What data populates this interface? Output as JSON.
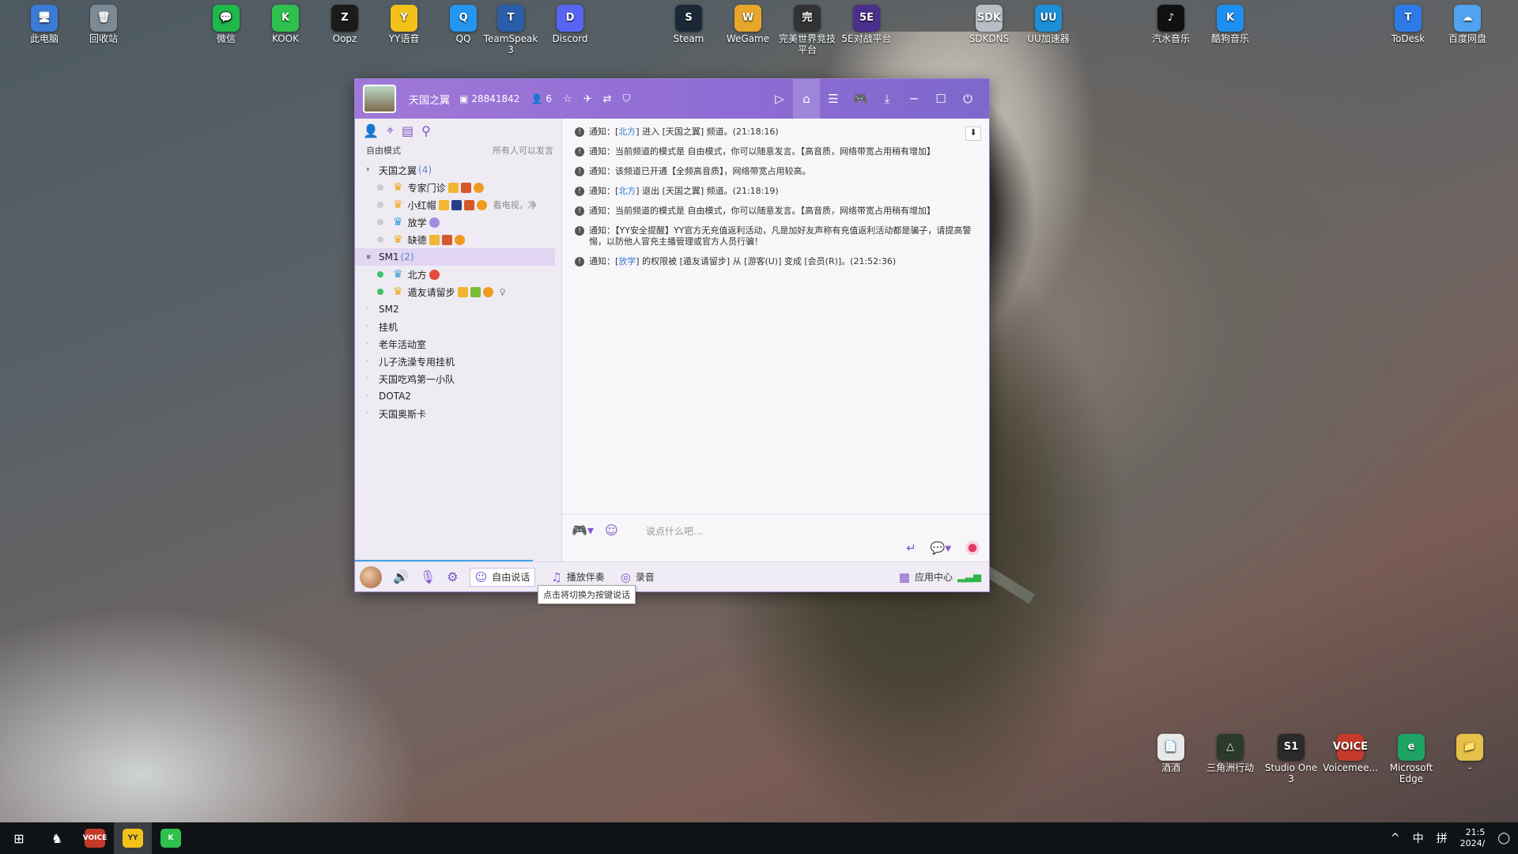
{
  "desktop": {
    "icons": [
      {
        "label": "此电脑",
        "color": "#3a7bd5",
        "glyph": "🖥"
      },
      {
        "label": "回收站",
        "color": "#7d8a96",
        "glyph": "🗑"
      },
      {
        "label": "微信",
        "color": "#1fb84a",
        "glyph": "💬"
      },
      {
        "label": "KOOK",
        "color": "#2ec14d",
        "glyph": "K"
      },
      {
        "label": "Oopz",
        "color": "#1b1b1b",
        "glyph": "Z"
      },
      {
        "label": "YY语音",
        "color": "#f2c21a",
        "glyph": "Y"
      },
      {
        "label": "QQ",
        "color": "#2496f0",
        "glyph": "Q"
      },
      {
        "label": "TeamSpeak 3",
        "color": "#2a5ea8",
        "glyph": "T"
      },
      {
        "label": "Discord",
        "color": "#5865f2",
        "glyph": "D"
      },
      {
        "label": "Steam",
        "color": "#1b2838",
        "glyph": "S"
      },
      {
        "label": "WeGame",
        "color": "#e7a62a",
        "glyph": "W"
      },
      {
        "label": "完美世界竞技平台",
        "color": "#333333",
        "glyph": "完"
      },
      {
        "label": "5E对战平台",
        "color": "#4a2f8c",
        "glyph": "5E"
      },
      {
        "label": "SDKDNS",
        "color": "#b8bec6",
        "glyph": "SDK"
      },
      {
        "label": "UU加速器",
        "color": "#1c8fd6",
        "glyph": "UU"
      },
      {
        "label": "汽水音乐",
        "color": "#111111",
        "glyph": "♪"
      },
      {
        "label": "酷狗音乐",
        "color": "#1e8ff0",
        "glyph": "K"
      },
      {
        "label": "ToDesk",
        "color": "#2e7be8",
        "glyph": "T"
      },
      {
        "label": "百度网盘",
        "color": "#4fa3f0",
        "glyph": "☁"
      }
    ],
    "bottom_icons": [
      {
        "label": "酒酒",
        "color": "#e8e8e8",
        "glyph": "📄"
      },
      {
        "label": "三角洲行动",
        "color": "#2c3a2c",
        "glyph": "△"
      },
      {
        "label": "Studio One 3",
        "color": "#2a2a2a",
        "glyph": "S1"
      },
      {
        "label": "Voicemee...",
        "color": "#c43a2a",
        "glyph": "VOICE"
      },
      {
        "label": "Microsoft Edge",
        "color": "#1da363",
        "glyph": "e"
      },
      {
        "label": "-",
        "color": "#e5c14a",
        "glyph": "📁"
      }
    ]
  },
  "yy": {
    "title": {
      "channel_name": "天国之翼",
      "channel_id": "28841842",
      "online_count": "6"
    },
    "left": {
      "mode_label": "自由模式",
      "mode_note": "所有人可以发言",
      "root_channel": {
        "name": "天国之翼",
        "count": "(4)"
      },
      "root_users": [
        {
          "name": "专家门诊",
          "extra": ""
        },
        {
          "name": "小红帽",
          "extra": "看电视，净"
        },
        {
          "name": "放学",
          "extra": ""
        },
        {
          "name": "缺德",
          "extra": ""
        }
      ],
      "sub_channel": {
        "name": "SM1",
        "count": "(2)"
      },
      "sub_users": [
        {
          "name": "北方",
          "extra": ""
        },
        {
          "name": "遁友请留步",
          "extra": "♀"
        }
      ],
      "other_channels": [
        "SM2",
        "挂机",
        "老年活动室",
        "儿子洗澡专用挂机",
        "天国吃鸡第一小队",
        "DOTA2",
        "天国奥斯卡"
      ]
    },
    "messages": [
      {
        "prefix": "通知：[",
        "link": "北方",
        "suffix": "] 进入 [天国之翼] 频道。(21:18:16)"
      },
      {
        "prefix": "通知：当前频道的模式是 自由模式，你可以随意发言。【高音质，网络带宽占用稍有增加】",
        "link": "",
        "suffix": ""
      },
      {
        "prefix": "通知：该频道已开通【全频高音质】，网络带宽占用较高。",
        "link": "",
        "suffix": ""
      },
      {
        "prefix": "通知：[",
        "link": "北方",
        "suffix": "] 退出 [天国之翼] 频道。(21:18:19)"
      },
      {
        "prefix": "通知：当前频道的模式是 自由模式，你可以随意发言。【高音质，网络带宽占用稍有增加】",
        "link": "",
        "suffix": ""
      },
      {
        "prefix": "通知：【YY安全提醒】YY官方无充值返利活动，凡是加好友声称有充值返利活动都是骗子，请提高警惕，以防他人冒充主播管理或官方人员行骗！",
        "link": "",
        "suffix": ""
      },
      {
        "prefix": "通知：[",
        "link": "放学",
        "suffix": "] 的权限被 [遁友请留步] 从 [游客(U)] 变成 [会员(R)]。(21:52:36)"
      }
    ],
    "input_placeholder": "说点什么吧...",
    "bottom": {
      "free_speak": "自由说话",
      "play_music": "播放伴奏",
      "record": "录音",
      "app_center": "应用中心"
    },
    "tooltip": "点击将切换为按键说话"
  },
  "taskbar": {
    "ime": "中",
    "layout": "拼",
    "time": "21:5",
    "date": "2024/"
  }
}
